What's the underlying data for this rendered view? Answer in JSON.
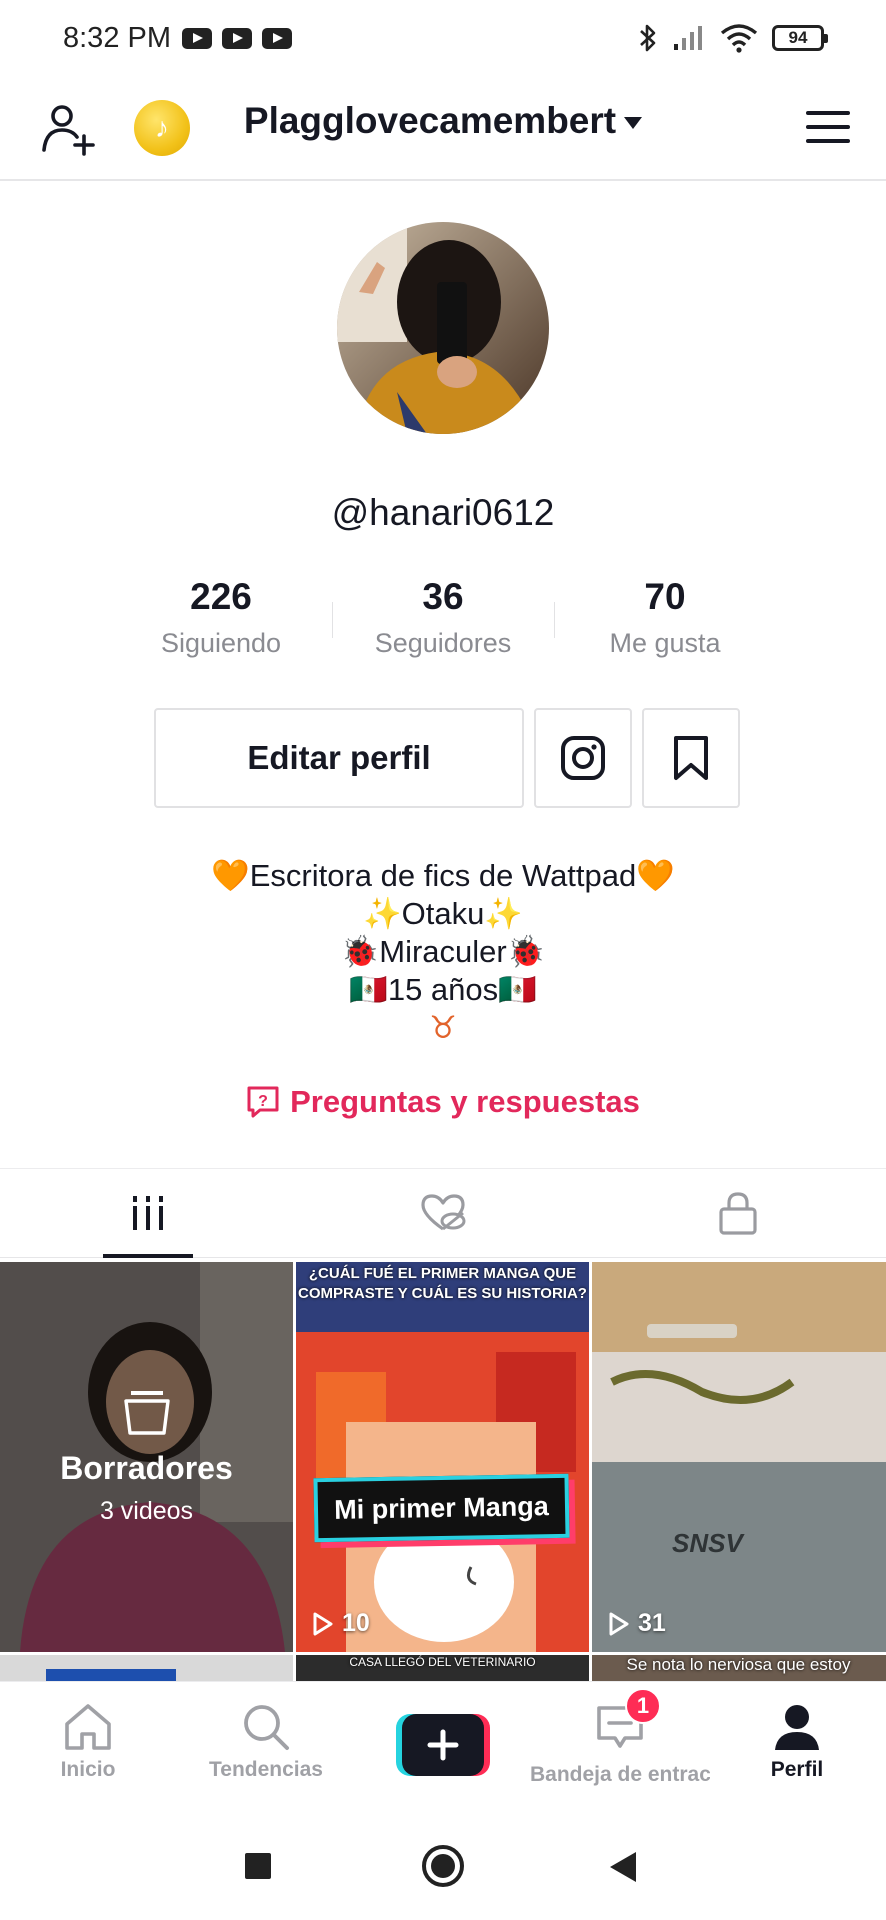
{
  "status_bar": {
    "time": "8:32 PM",
    "battery": "94"
  },
  "header": {
    "account_name": "Plagglovecamembert"
  },
  "profile": {
    "username": "@hanari0612",
    "stats": [
      {
        "value": "226",
        "label": "Siguiendo"
      },
      {
        "value": "36",
        "label": "Seguidores"
      },
      {
        "value": "70",
        "label": "Me gusta"
      }
    ],
    "edit_button": "Editar perfil",
    "bio_lines": [
      "🧡Escritora de fics de Wattpad🧡",
      "✨Otaku✨",
      "🐞Miraculer🐞",
      "🇲🇽15 años🇲🇽",
      "♉"
    ],
    "qa_link": "Preguntas y respuestas"
  },
  "videos": [
    {
      "type": "drafts",
      "title": "Borradores",
      "count": "3 videos"
    },
    {
      "type": "video",
      "caption": "¿CUÁL FUÉ EL PRIMER MANGA QUE COMPRASTE Y CUÁL ES SU HISTORIA?",
      "banner": "Mi primer Manga",
      "views": "10"
    },
    {
      "type": "video",
      "views": "31"
    }
  ],
  "next_row_captions": [
    "CASA LLEGÓ DEL VETERINARIO",
    "Se nota lo nerviosa que estoy"
  ],
  "bottom_nav": {
    "items": [
      "Inicio",
      "Tendencias",
      "Bandeja de entrac",
      "Perfil"
    ],
    "inbox_badge": "1"
  },
  "colors": {
    "accent": "#fe2c55",
    "qa": "#e2285b",
    "text": "#161823",
    "muted": "#8a8b91"
  }
}
